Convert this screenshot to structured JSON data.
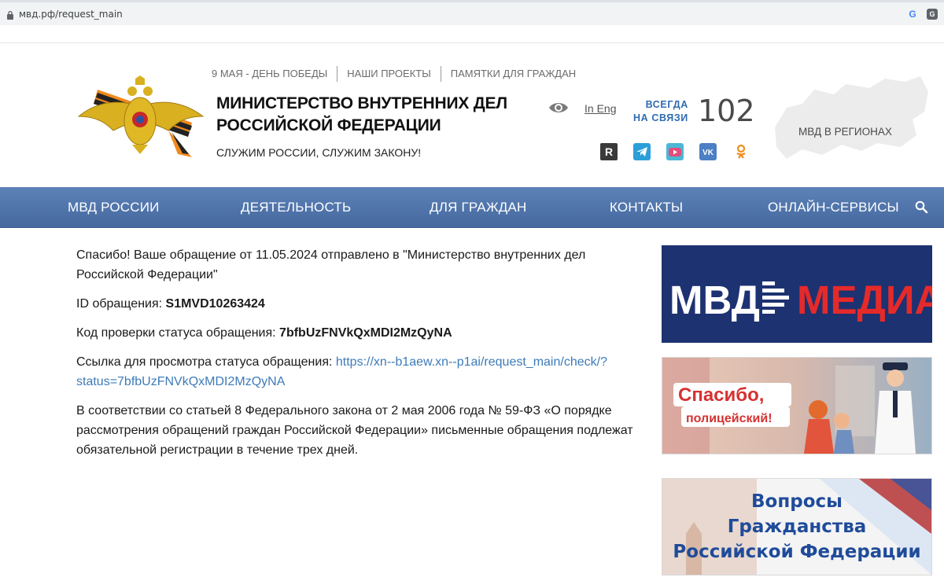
{
  "browser": {
    "url": "мвд.рф/request_main"
  },
  "header": {
    "top_links": [
      "9 МАЯ - ДЕНЬ ПОБЕДЫ",
      "НАШИ ПРОЕКТЫ",
      "ПАМЯТКИ ДЛЯ ГРАЖДАН"
    ],
    "title": "МИНИСТЕРСТВО ВНУТРЕННИХ ДЕЛ РОССИЙСКОЙ ФЕДЕРАЦИИ",
    "motto": "СЛУЖИМ РОССИИ, СЛУЖИМ ЗАКОНУ!",
    "lang_link": "In Eng",
    "always_line1": "ВСЕГДА",
    "always_line2": "НА СВЯЗИ",
    "phone": "102",
    "regions_link": "МВД В РЕГИОНАХ",
    "social_icons": [
      "rutube-icon",
      "telegram-icon",
      "video-icon",
      "vk-icon",
      "ok-icon"
    ]
  },
  "nav": {
    "items": [
      "МВД РОССИИ",
      "ДЕЯТЕЛЬНОСТЬ",
      "ДЛЯ ГРАЖДАН",
      "КОНТАКТЫ",
      "ОНЛАЙН-СЕРВИСЫ"
    ]
  },
  "main": {
    "thanks_text": "Спасибо! Ваше обращение от 11.05.2024 отправлено в \"Министерство внутренних дел Российской Федерации\"",
    "id_label": "ID обращения: ",
    "id_value": "S1MVD10263424",
    "code_label": "Код проверки статуса обращения: ",
    "code_value": "7bfbUzFNVkQxMDI2MzQyNA",
    "link_label": "Ссылка для просмотра статуса обращения: ",
    "link_value": "https://xn--b1aew.xn--p1ai/request_main/check/?status=7bfbUzFNVkQxMDI2MzQyNA",
    "law_text": "В соответствии со статьей 8 Федерального закона от 2 мая 2006 года № 59-ФЗ «О порядке рассмотрения обращений граждан Российской Федерации» письменные обращения подлежат обязательной регистрации в течение трех дней."
  },
  "banners": {
    "media_left": "МВД",
    "media_right": "МЕДИА",
    "thanks_line1": "Спасибо,",
    "thanks_line2": "полицейский!",
    "cit_line1": "Вопросы",
    "cit_line2": "Гражданства",
    "cit_line3": "Российской Федерации"
  },
  "colors": {
    "nav_bg": "#4f75ab",
    "link": "#3d7bb8",
    "media_bg": "#1d3271",
    "media_red": "#e52a2a",
    "citizenship_text": "#1f4b9a"
  }
}
